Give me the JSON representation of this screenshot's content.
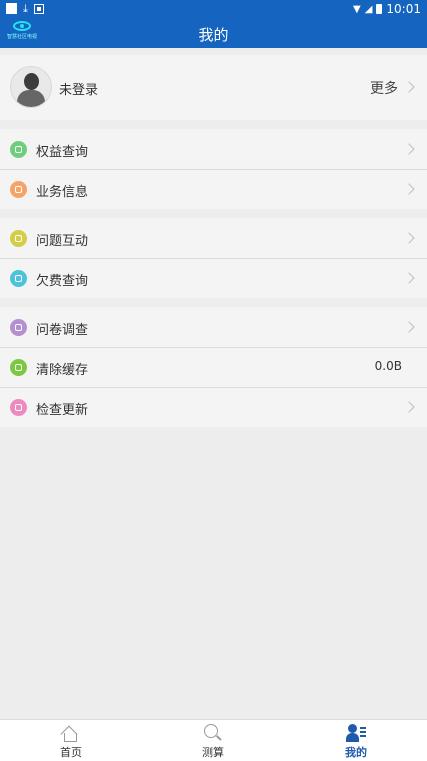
{
  "status_bar": {
    "time": "10:01"
  },
  "header": {
    "title": "我的",
    "logo_text": "智慧社区电视"
  },
  "profile": {
    "name": "未登录",
    "more_label": "更多"
  },
  "menu": [
    {
      "label": "权益查询",
      "color": "#6fce7d",
      "icon": "rights-icon",
      "chevron": true
    },
    {
      "label": "业务信息",
      "color": "#f5a468",
      "icon": "business-icon",
      "chevron": true
    },
    {
      "label": "问题互动",
      "color": "#d4cd48",
      "icon": "interaction-icon",
      "chevron": true
    },
    {
      "label": "欠费查询",
      "color": "#4cc3d9",
      "icon": "arrears-icon",
      "chevron": true
    },
    {
      "label": "问卷调查",
      "color": "#b58fd0",
      "icon": "survey-icon",
      "chevron": true
    },
    {
      "label": "清除缓存",
      "color": "#7ac943",
      "icon": "cache-icon",
      "value": "0.0B"
    },
    {
      "label": "检查更新",
      "color": "#ef8ac1",
      "icon": "update-icon",
      "chevron": true
    }
  ],
  "bottom_nav": [
    {
      "label": "首页",
      "icon": "home-icon"
    },
    {
      "label": "测算",
      "icon": "search-icon"
    },
    {
      "label": "我的",
      "icon": "user-icon",
      "active": true
    }
  ],
  "colors": {
    "brand": "#1565c0",
    "active_tab": "#1f5bab",
    "background": "#ededed"
  }
}
